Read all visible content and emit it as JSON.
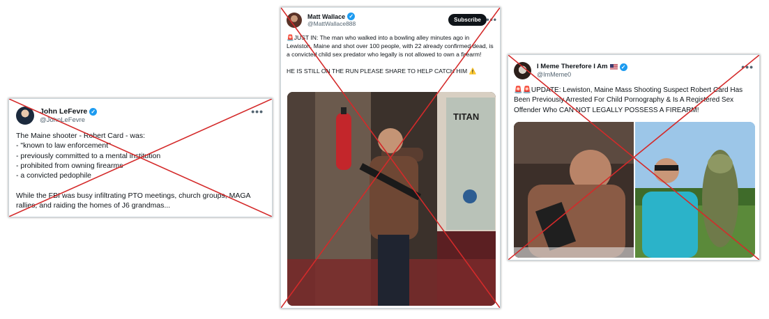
{
  "posts": [
    {
      "display_name": "John LeFevre",
      "handle": "@JohnLeFevre",
      "verified_icon": "verified-badge-icon",
      "more_icon": "more-options-icon",
      "more_label": "•••",
      "text": "The Maine shooter - Robert Card - was:\n- \"known to law enforcement\"\n- previously committed to a mental institution\n- prohibited from owning firearms\n- a convicted pedophile\n\nWhile the FBI was busy infiltrating PTO meetings, church groups, MAGA rallies, and raiding the homes of J6 grandmas..."
    },
    {
      "display_name": "Matt Wallace",
      "handle": "@MattWallace888",
      "verified_icon": "verified-badge-icon",
      "more_icon": "more-options-icon",
      "more_label": "•••",
      "subscribe_label": "Subscribe",
      "text": "🚨JUST IN: The man who walked into a bowling alley minutes ago in Lewiston, Maine and shot over 100 people, with 22 already confirmed dead, is a convicted child sex predator who legally is not allowed to own a firearm!\n\nHE IS STILL ON THE RUN PLEASE SHARE TO HELP CATCH HIM ⚠️",
      "photo_sign": "TITAN"
    },
    {
      "display_name": "I Meme Therefore I Am",
      "handle": "@ImMeme0",
      "verified_icon": "verified-badge-icon",
      "flag_icon": "us-flag-icon",
      "more_icon": "more-options-icon",
      "more_label": "•••",
      "text": "🚨🚨UPDATE: Lewiston, Maine Mass Shooting Suspect Robert Card Has Been Previously Arrested For Child Pornography & Is A Registered Sex Offender Who CAN NOT LEGALLY POSSESS A FIREARM!"
    }
  ],
  "cross_out_color": "#d42a2a",
  "verified_color": "#1d9bf0"
}
